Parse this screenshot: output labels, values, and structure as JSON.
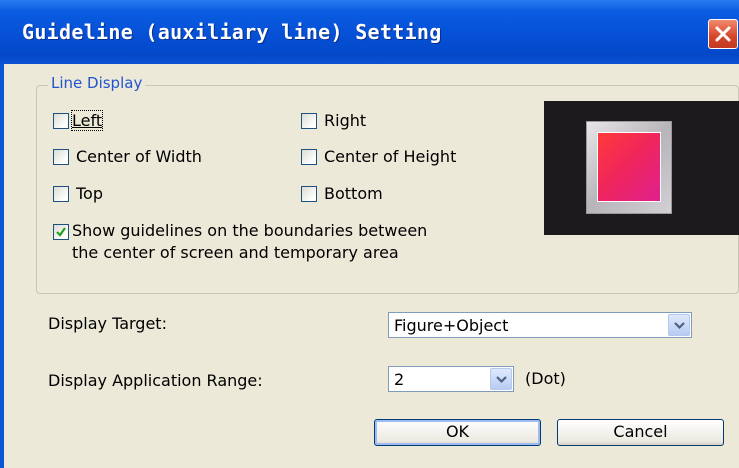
{
  "window": {
    "title": "Guideline (auxiliary line) Setting",
    "close_icon": "close-icon",
    "accent": "#0a55d8",
    "face": "#ece9d8"
  },
  "line_display": {
    "legend": "Line Display",
    "options": [
      {
        "key": "left",
        "label": "Left",
        "checked": false
      },
      {
        "key": "right",
        "label": "Right",
        "checked": false
      },
      {
        "key": "center_width",
        "label": "Center of Width",
        "checked": false
      },
      {
        "key": "center_height",
        "label": "Center of Height",
        "checked": false
      },
      {
        "key": "top",
        "label": "Top",
        "checked": false
      },
      {
        "key": "bottom",
        "label": "Bottom",
        "checked": false
      }
    ],
    "boundaries": {
      "line1": "Show guidelines on the boundaries between",
      "line2": "the center of screen and temporary area",
      "checked": true
    }
  },
  "display_target": {
    "label": "Display Target:",
    "value": "Figure+Object"
  },
  "application_range": {
    "label": "Display Application Range:",
    "value": "2",
    "unit": "(Dot)"
  },
  "buttons": {
    "ok": "OK",
    "cancel": "Cancel"
  }
}
